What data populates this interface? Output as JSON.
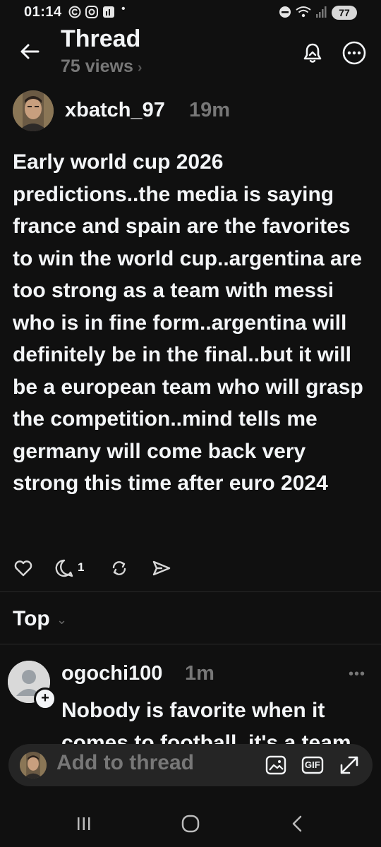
{
  "status_bar": {
    "time": "01:14",
    "battery": "77"
  },
  "header": {
    "title": "Thread",
    "views": "75 views"
  },
  "post": {
    "username": "xbatch_97",
    "time": "19m",
    "text": "Early world cup 2026 predictions..the media is saying france and spain are the favorites to win the world cup..argentina are too strong as a team with messi who is in fine form..argentina will definitely be in the final..but it will be a european team who will grasp the competition..mind tells me germany will come back very strong this time after euro 2024",
    "reply_count": "1"
  },
  "sort": {
    "label": "Top"
  },
  "reply": {
    "username": "ogochi100",
    "time": "1m",
    "text": "Nobody is favorite when it comes to football, it's a team"
  },
  "composer": {
    "placeholder": "Add to thread",
    "gif_label": "GIF"
  },
  "icons": {
    "back": "arrow-left-icon",
    "bell": "bell-icon",
    "more": "more-horizontal-icon",
    "like": "heart-icon",
    "reply": "comment-icon",
    "repost": "repost-icon",
    "share": "send-icon",
    "image": "image-icon",
    "gif": "gif-icon",
    "expand": "expand-icon"
  },
  "colors": {
    "background": "#101010",
    "text": "#f3f5f7",
    "muted": "#777777",
    "composer_bg": "#252525"
  }
}
